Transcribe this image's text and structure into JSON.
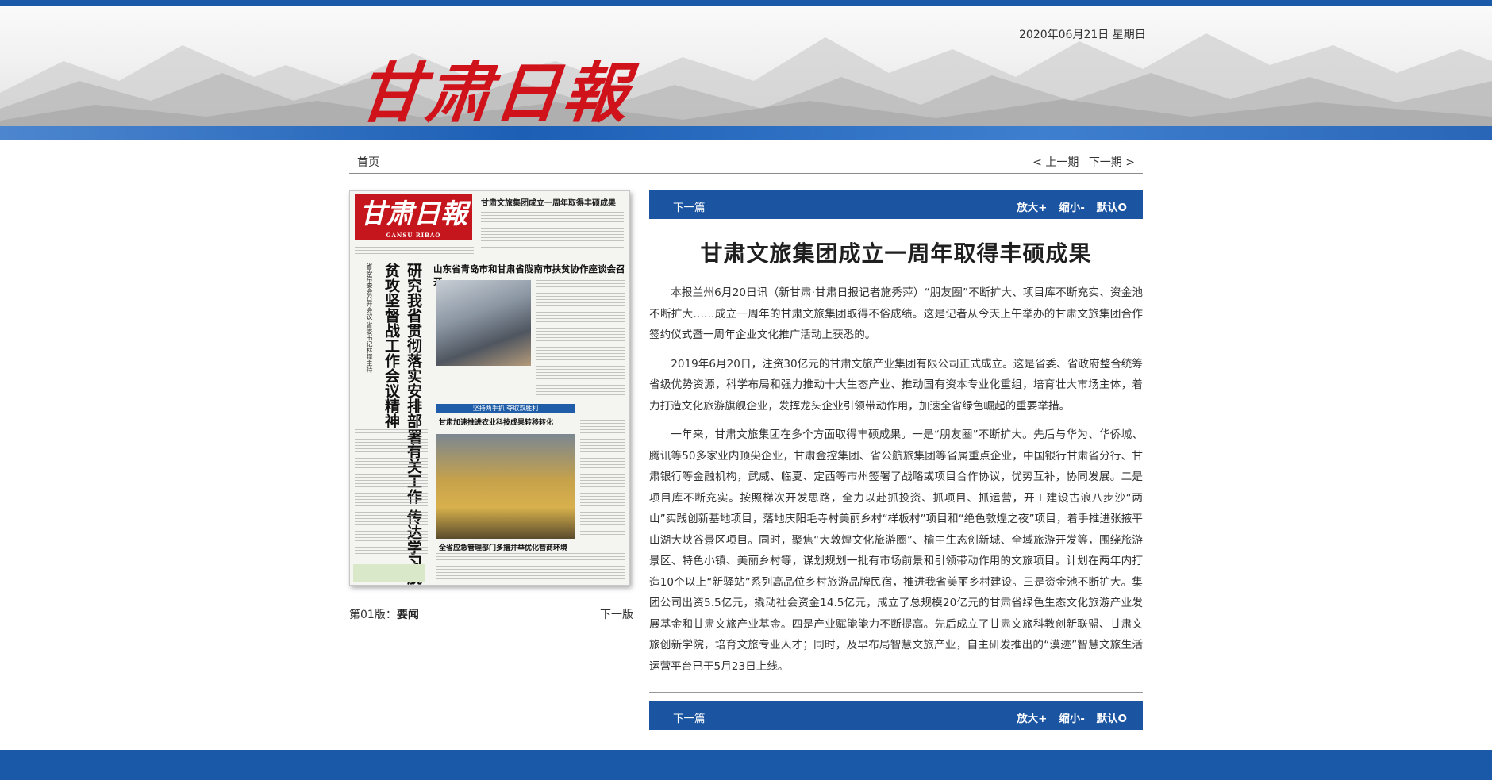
{
  "header": {
    "logo_text": "甘肃日報",
    "date": "2020年06月21日  星期日",
    "colors": {
      "brand_red": "#d0121b",
      "brand_blue": "#1b55a2"
    }
  },
  "nav": {
    "home": "首页",
    "prev_issue": "< 上一期",
    "next_issue": "下一期 >"
  },
  "thumbnail": {
    "masthead": "甘肃日報",
    "masthead_sub": "GANSU RIBAO",
    "top_headline": "甘肃文旅集团成立一周年取得丰硕成果",
    "main_headline": "山东省青岛市和甘肃省陇南市扶贫协作座谈会召开",
    "vertical_headline": "研究我省贯彻落实安排部署有关工作 传达学习脱贫攻坚督战工作会议精神",
    "vertical_small": "省委常委会召开会议 省委书记林铎主持",
    "band_text": "坚持两手抓 夺取双胜利",
    "sub_headline_1": "甘肃加速推进农业科技成果转移转化",
    "sub_headline_2": "全省应急管理部门多措并举优化营商环境",
    "page_label_prefix": "第01版：",
    "page_label_name": "要闻",
    "next_page": "下一版"
  },
  "toolbar": {
    "next_article": "下一篇",
    "zoom_in": "放大+",
    "zoom_out": "缩小-",
    "reset": "默认O"
  },
  "article": {
    "title": "甘肃文旅集团成立一周年取得丰硕成果",
    "paragraphs": [
      "本报兰州6月20日讯（新甘肃·甘肃日报记者施秀萍）“朋友圈”不断扩大、项目库不断充实、资金池不断扩大……成立一周年的甘肃文旅集团取得不俗成绩。这是记者从今天上午举办的甘肃文旅集团合作签约仪式暨一周年企业文化推广活动上获悉的。",
      "2019年6月20日，注资30亿元的甘肃文旅产业集团有限公司正式成立。这是省委、省政府整合统筹省级优势资源，科学布局和强力推动十大生态产业、推动国有资本专业化重组，培育壮大市场主体，着力打造文化旅游旗舰企业，发挥龙头企业引领带动作用，加速全省绿色崛起的重要举措。",
      "一年来，甘肃文旅集团在多个方面取得丰硕成果。一是“朋友圈”不断扩大。先后与华为、华侨城、腾讯等50多家业内顶尖企业，甘肃金控集团、省公航旅集团等省属重点企业，中国银行甘肃省分行、甘肃银行等金融机构，武威、临夏、定西等市州签署了战略或项目合作协议，优势互补，协同发展。二是项目库不断充实。按照梯次开发思路，全力以赴抓投资、抓项目、抓运营，开工建设古浪八步沙“两山”实践创新基地项目，落地庆阳毛寺村美丽乡村“样板村”项目和“绝色敦煌之夜”项目，着手推进张掖平山湖大峡谷景区项目。同时，聚焦“大敦煌文化旅游圈”、榆中生态创新城、全域旅游开发等，围绕旅游景区、特色小镇、美丽乡村等，谋划规划一批有市场前景和引领带动作用的文旅项目。计划在两年内打造10个以上“新驿站”系列高品位乡村旅游品牌民宿，推进我省美丽乡村建设。三是资金池不断扩大。集团公司出资5.5亿元，撬动社会资金14.5亿元，成立了总规模20亿元的甘肃省绿色生态文化旅游产业发展基金和甘肃文旅产业基金。四是产业赋能能力不断提高。先后成立了甘肃文旅科教创新联盟、甘肃文旅创新学院，培育文旅专业人才；同时，及早布局智慧文旅产业，自主研发推出的“漠迹”智慧文旅生活运营平台已于5月23日上线。"
    ]
  }
}
